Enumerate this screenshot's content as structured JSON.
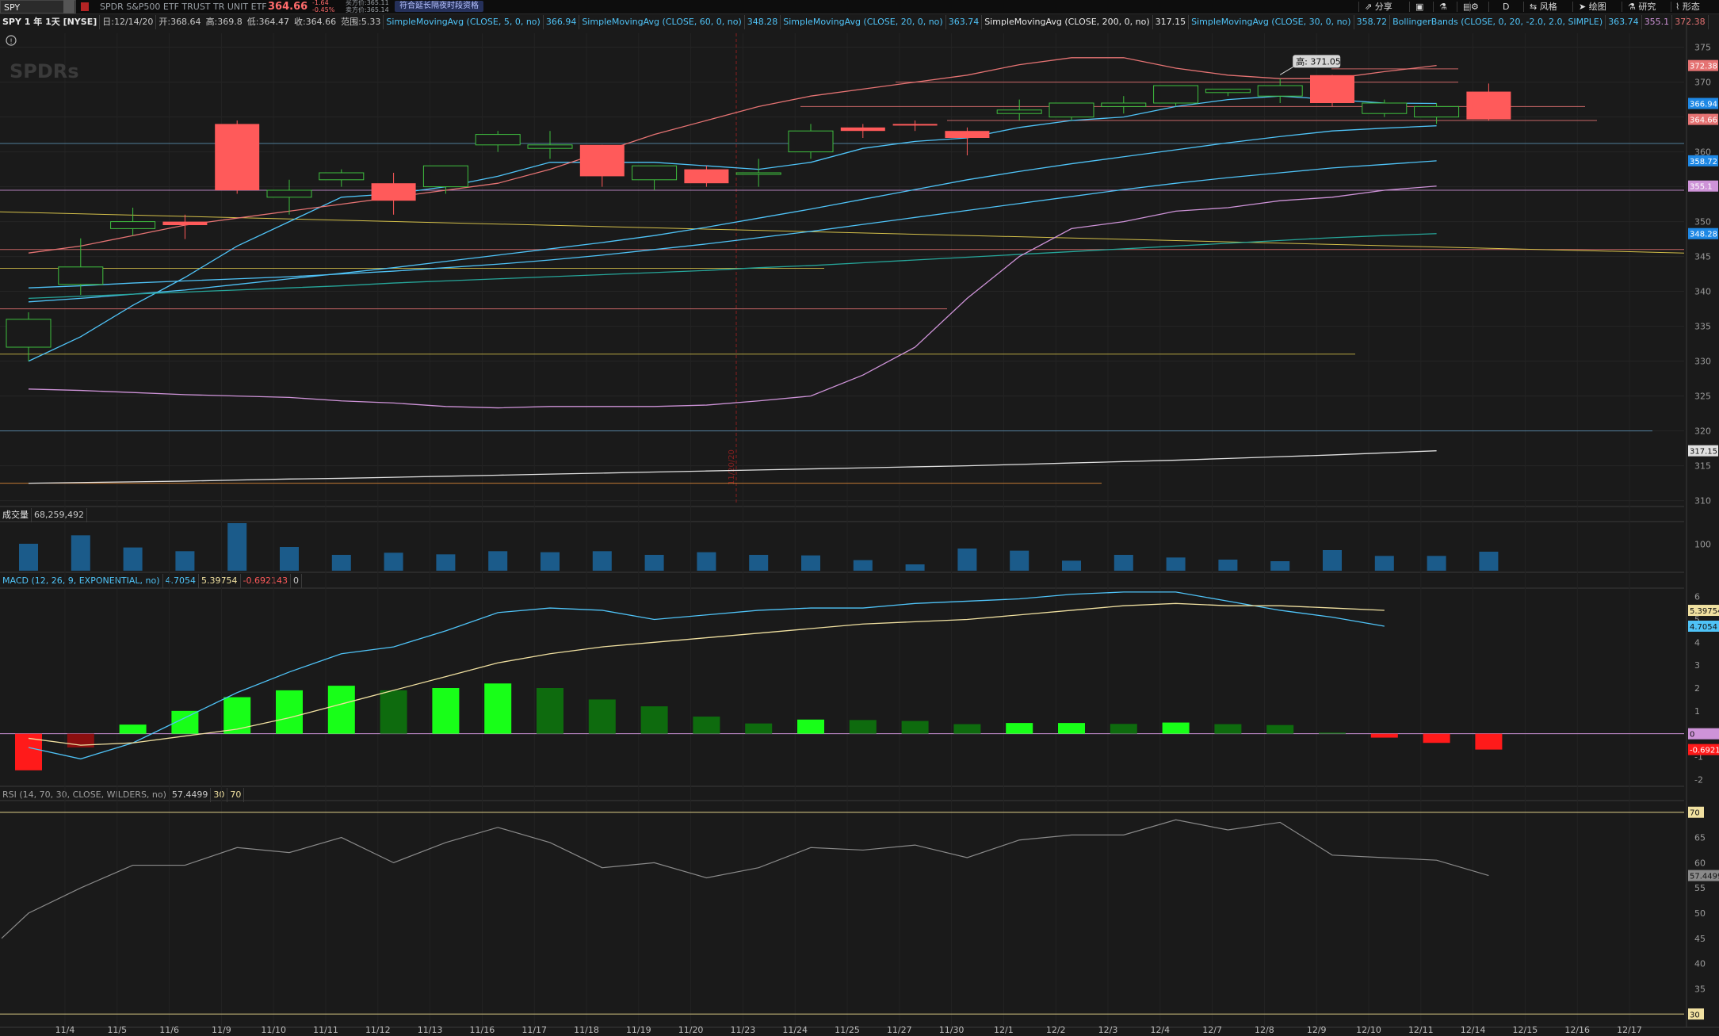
{
  "toolbar": {
    "symbol": "SPY",
    "description": "SPDR S&P500 ETF TRUST TR UNIT ETF",
    "last_price": "364.66",
    "change_abs": "-1.64",
    "change_pct": "-0.45%",
    "bid": "买方价:365.11",
    "ask": "卖方价:365.14",
    "extended_hours_badge": "符合延长隔夜时段资格",
    "share_label": "分享",
    "timeframe": "D",
    "style_label": "风格",
    "draw_label": "绘图",
    "study_label": "研究",
    "pattern_label": "形态"
  },
  "info_line": {
    "title": "SPY 1 年 1天 [NYSE]",
    "date": "日:12/14/20",
    "open": "开:368.64",
    "high": "高:369.8",
    "low": "低:364.47",
    "close": "收:364.66",
    "range": "范围:5.33",
    "studies": [
      {
        "label": "SimpleMovingAvg (CLOSE, 5, 0, no)",
        "value": "366.94",
        "color": "#4fc3f7"
      },
      {
        "label": "SimpleMovingAvg (CLOSE, 60, 0, no)",
        "value": "348.28",
        "color": "#4fc3f7"
      },
      {
        "label": "SimpleMovingAvg (CLOSE, 20, 0, no)",
        "value": "363.74",
        "color": "#4fc3f7"
      },
      {
        "label": "SimpleMovingAvg (CLOSE, 200, 0, no)",
        "value": "317.15",
        "color": "#e8e8e8"
      },
      {
        "label": "SimpleMovingAvg (CLOSE, 30, 0, no)",
        "value": "358.72",
        "color": "#4fc3f7"
      },
      {
        "label": "BollingerBands (CLOSE, 0, 20, -2.0, 2.0, SIMPLE)",
        "value": "363.74",
        "value2": "355.1",
        "value3": "372.38",
        "color": "#4fc3f7"
      }
    ]
  },
  "volume_panel": {
    "label": "成交量",
    "value": "68,259,492"
  },
  "macd_panel": {
    "label": "MACD (12, 26, 9, EXPONENTIAL, no)",
    "value": "4.7054",
    "avg": "5.39754",
    "diff": "-0.692143",
    "zero": "0"
  },
  "rsi_panel": {
    "label": "RSI (14, 70, 30, CLOSE, WILDERS, no)",
    "value": "57.4499",
    "os": "30",
    "ob": "70"
  },
  "watermark": "SPDRs",
  "high_callout": "高: 371.05",
  "vertical_marker_date": "11/20/20",
  "colors": {
    "up": "#3fbf3f",
    "down": "#ff5a5a",
    "bg": "#1a1a1a",
    "grid": "#2b2b2b",
    "accent_blue": "#4fc3f7"
  },
  "chart_data": {
    "type": "candlestick",
    "price_axis": {
      "ticks": [
        310,
        315,
        320,
        325,
        330,
        335,
        340,
        345,
        350,
        355,
        360,
        365,
        370,
        375
      ],
      "range": [
        309.5,
        377
      ]
    },
    "x_labels": [
      "11/4",
      "11/5",
      "11/6",
      "11/9",
      "11/10",
      "11/11",
      "11/12",
      "11/13",
      "11/16",
      "11/17",
      "11/18",
      "11/19",
      "11/20",
      "11/23",
      "11/24",
      "11/25",
      "11/27",
      "11/30",
      "12/1",
      "12/2",
      "12/3",
      "12/4",
      "12/7",
      "12/8",
      "12/9",
      "12/10",
      "12/11",
      "12/14",
      "12/15",
      "12/16",
      "12/17"
    ],
    "candles": [
      {
        "o": 332.0,
        "h": 337.0,
        "l": 330.0,
        "c": 336.0
      },
      {
        "o": 341.0,
        "h": 347.6,
        "l": 339.5,
        "c": 343.5
      },
      {
        "o": 349.0,
        "h": 352.0,
        "l": 348.0,
        "c": 350.0
      },
      {
        "o": 350.0,
        "h": 351.0,
        "l": 347.5,
        "c": 349.5
      },
      {
        "o": 364.0,
        "h": 364.5,
        "l": 354.0,
        "c": 354.5
      },
      {
        "o": 353.5,
        "h": 356.0,
        "l": 351.0,
        "c": 354.5
      },
      {
        "o": 356.0,
        "h": 357.5,
        "l": 355.0,
        "c": 357.0
      },
      {
        "o": 355.5,
        "h": 357.0,
        "l": 351.0,
        "c": 353.0
      },
      {
        "o": 355.0,
        "h": 358.0,
        "l": 354.0,
        "c": 358.0
      },
      {
        "o": 361.0,
        "h": 363.0,
        "l": 360.0,
        "c": 362.5
      },
      {
        "o": 360.5,
        "h": 363.0,
        "l": 359.0,
        "c": 361.0
      },
      {
        "o": 361.0,
        "h": 361.0,
        "l": 355.0,
        "c": 356.5
      },
      {
        "o": 356.0,
        "h": 358.0,
        "l": 354.5,
        "c": 358.0
      },
      {
        "o": 357.5,
        "h": 358.0,
        "l": 355.0,
        "c": 355.5
      },
      {
        "o": 357.0,
        "h": 359.0,
        "l": 355.0,
        "c": 357.0
      },
      {
        "o": 360.0,
        "h": 364.0,
        "l": 359.0,
        "c": 363.0
      },
      {
        "o": 363.5,
        "h": 364.0,
        "l": 362.0,
        "c": 363.0
      },
      {
        "o": 364.0,
        "h": 364.5,
        "l": 363.0,
        "c": 363.8
      },
      {
        "o": 363.0,
        "h": 363.5,
        "l": 359.5,
        "c": 362.0
      },
      {
        "o": 365.5,
        "h": 367.5,
        "l": 364.5,
        "c": 366.0
      },
      {
        "o": 365.0,
        "h": 367.0,
        "l": 364.5,
        "c": 367.0
      },
      {
        "o": 366.5,
        "h": 368.0,
        "l": 365.5,
        "c": 367.0
      },
      {
        "o": 367.0,
        "h": 369.5,
        "l": 366.5,
        "c": 369.5
      },
      {
        "o": 368.5,
        "h": 369.0,
        "l": 368.0,
        "c": 369.0
      },
      {
        "o": 368.0,
        "h": 370.5,
        "l": 367.0,
        "c": 369.5
      },
      {
        "o": 371.0,
        "h": 371.05,
        "l": 366.5,
        "c": 367.0
      },
      {
        "o": 365.5,
        "h": 367.5,
        "l": 365.0,
        "c": 367.0
      },
      {
        "o": 365.0,
        "h": 367.0,
        "l": 364.0,
        "c": 366.5
      },
      {
        "o": 368.64,
        "h": 369.8,
        "l": 364.47,
        "c": 364.66
      }
    ],
    "series": [
      {
        "name": "SMA5",
        "color": "#4fc3f7",
        "values": [
          330.0,
          333.5,
          338.0,
          342.0,
          346.5,
          350.0,
          353.5,
          354.0,
          355.0,
          356.5,
          358.5,
          358.5,
          358.5,
          358.0,
          357.5,
          358.5,
          360.5,
          361.5,
          362.0,
          363.5,
          364.5,
          365.0,
          366.5,
          367.5,
          368.0,
          367.5,
          367.0,
          366.94
        ]
      },
      {
        "name": "SMA20",
        "color": "#4fc3f7",
        "values": [
          338.5,
          339.0,
          339.6,
          340.2,
          341.0,
          341.8,
          342.6,
          343.4,
          344.3,
          345.2,
          346.1,
          347.0,
          348.0,
          349.2,
          350.5,
          351.8,
          353.2,
          354.6,
          356.0,
          357.2,
          358.3,
          359.3,
          360.3,
          361.3,
          362.2,
          363.0,
          363.4,
          363.74
        ]
      },
      {
        "name": "SMA30",
        "color": "#4fc3f7",
        "values": [
          340.5,
          340.8,
          341.2,
          341.5,
          341.8,
          342.1,
          342.5,
          342.9,
          343.4,
          343.9,
          344.5,
          345.2,
          346.0,
          346.8,
          347.7,
          348.6,
          349.6,
          350.6,
          351.6,
          352.6,
          353.6,
          354.6,
          355.5,
          356.3,
          357.0,
          357.7,
          358.2,
          358.72
        ]
      },
      {
        "name": "SMA60",
        "color": "#26a69a",
        "values": [
          339.0,
          339.3,
          339.6,
          339.9,
          340.2,
          340.5,
          340.8,
          341.2,
          341.5,
          341.8,
          342.1,
          342.4,
          342.7,
          343.0,
          343.4,
          343.7,
          344.1,
          344.5,
          344.9,
          345.3,
          345.7,
          346.1,
          346.5,
          346.9,
          347.3,
          347.7,
          348.0,
          348.28
        ]
      },
      {
        "name": "SMA200",
        "color": "#e0e0e0",
        "values": [
          312.5,
          312.6,
          312.7,
          312.8,
          312.95,
          313.1,
          313.2,
          313.35,
          313.5,
          313.65,
          313.8,
          313.95,
          314.1,
          314.25,
          314.4,
          314.55,
          314.7,
          314.85,
          315.0,
          315.2,
          315.4,
          315.6,
          315.8,
          316.05,
          316.3,
          316.55,
          316.85,
          317.15
        ]
      },
      {
        "name": "BBUpper",
        "color": "#e57373",
        "values": [
          345.5,
          346.5,
          348.0,
          349.5,
          350.5,
          351.5,
          352.5,
          353.5,
          354.5,
          355.5,
          357.5,
          360.0,
          362.5,
          364.5,
          366.5,
          368.0,
          369.0,
          370.0,
          371.0,
          372.5,
          373.5,
          373.5,
          372.0,
          371.0,
          370.5,
          370.5,
          371.5,
          372.38
        ]
      },
      {
        "name": "BBLower",
        "color": "#ce93d8",
        "values": [
          326.0,
          325.8,
          325.5,
          325.2,
          325.0,
          324.8,
          324.3,
          324.0,
          323.5,
          323.3,
          323.5,
          323.5,
          323.5,
          323.7,
          324.3,
          325.0,
          328.0,
          332.0,
          339.0,
          345.0,
          349.0,
          350.0,
          351.5,
          352.0,
          353.0,
          353.5,
          354.5,
          355.1
        ]
      }
    ],
    "horizontal_lines": [
      {
        "y": 361.2,
        "color": "#5b8fb0"
      },
      {
        "y": 354.5,
        "color": "#ce93d8"
      },
      {
        "y": 346.0,
        "color": "#e57373"
      },
      {
        "y": 343.3,
        "color": "#d4c04a"
      },
      {
        "y": 337.5,
        "color": "#e57373"
      },
      {
        "y": 331.0,
        "color": "#d4c04a"
      },
      {
        "y": 320.0,
        "color": "#5b8fb0"
      },
      {
        "y": 312.5,
        "color": "#e08a3a"
      },
      {
        "y": 370.0,
        "color": "#e57373"
      },
      {
        "y": 366.5,
        "color": "#e57373"
      },
      {
        "y": 364.5,
        "color": "#e57373"
      },
      {
        "y": 371.9,
        "color": "#e57373"
      }
    ],
    "volume": [
      102,
      134,
      88,
      74,
      180,
      90,
      60,
      68,
      62,
      74,
      70,
      74,
      60,
      70,
      60,
      58,
      40,
      24,
      84,
      76,
      38,
      60,
      50,
      42,
      36,
      78,
      56,
      56,
      72
    ],
    "macd": {
      "zero_range": [
        -2.3,
        6.3
      ],
      "ticks": [
        -2,
        -1,
        0,
        1,
        2,
        3,
        4,
        5,
        6
      ],
      "value": [
        -0.6,
        -1.1,
        -0.4,
        0.7,
        1.8,
        2.7,
        3.5,
        3.8,
        4.5,
        5.3,
        5.5,
        5.4,
        5.0,
        5.2,
        5.4,
        5.5,
        5.5,
        5.7,
        5.8,
        5.9,
        6.1,
        6.2,
        6.2,
        5.8,
        5.4,
        5.1,
        4.7054
      ],
      "signal": [
        -0.2,
        -0.5,
        -0.4,
        -0.1,
        0.2,
        0.7,
        1.3,
        1.9,
        2.5,
        3.1,
        3.5,
        3.8,
        4.0,
        4.2,
        4.4,
        4.6,
        4.8,
        4.9,
        5.0,
        5.2,
        5.4,
        5.6,
        5.7,
        5.6,
        5.6,
        5.5,
        5.39754
      ],
      "hist": [
        -1.6,
        -0.6,
        0.4,
        1.0,
        1.6,
        1.9,
        2.1,
        1.9,
        2.0,
        2.2,
        2.0,
        1.5,
        1.2,
        0.75,
        0.45,
        0.62,
        0.6,
        0.56,
        0.42,
        0.47,
        0.47,
        0.43,
        0.49,
        0.42,
        0.38,
        0.05,
        -0.17,
        -0.4,
        -0.692
      ]
    },
    "rsi": {
      "range": [
        28,
        72
      ],
      "ticks": [
        30,
        35,
        40,
        45,
        50,
        55,
        60,
        65,
        70
      ],
      "values": [
        45,
        50,
        55,
        59.5,
        59.5,
        63,
        62,
        65,
        60,
        64,
        67,
        64,
        59,
        60,
        57,
        59,
        63,
        62.5,
        63.5,
        61,
        64.5,
        65.5,
        65.5,
        68.5,
        66.5,
        68,
        61.5,
        61,
        60.5,
        57.4499
      ]
    }
  }
}
